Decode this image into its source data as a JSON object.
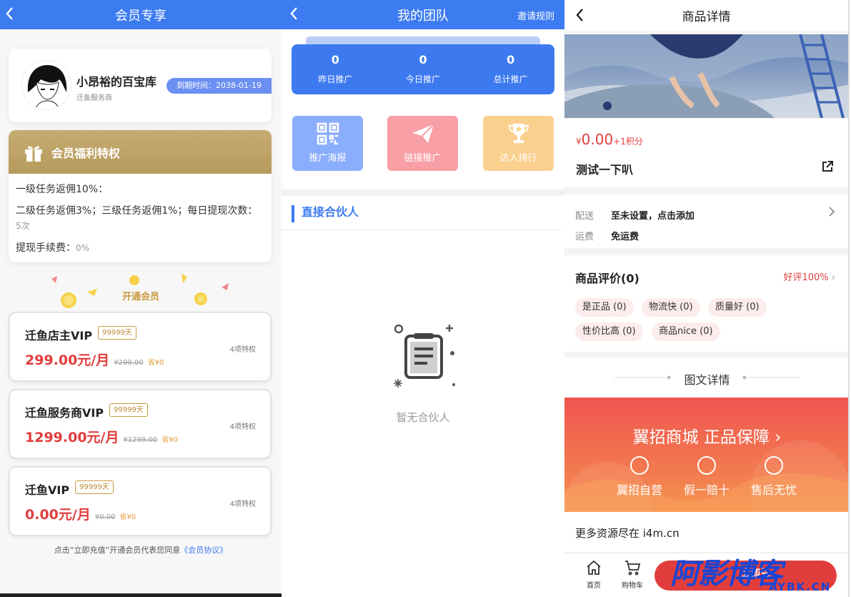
{
  "panel1": {
    "title": "会员专享",
    "user": {
      "name": "小昂裕的百宝库",
      "role": "迁鱼服务商",
      "expire": "到期时间：2038-01-19"
    },
    "benefit": {
      "title": "会员福利特权",
      "line1": "一级任务返佣10%：",
      "line2": "二级任务返佣3%；三级任务返佣1%；每日提现次数：",
      "line2_value": "5次",
      "line3": "提现手续费：",
      "line3_value": "0%"
    },
    "open_vip": "开通会员",
    "vips": [
      {
        "name": "迁鱼店主VIP",
        "days": "99999天",
        "price": "299.00元/月",
        "orig": "¥299.00",
        "save": "省¥0",
        "perks": "4项特权"
      },
      {
        "name": "迁鱼服务商VIP",
        "days": "99999天",
        "price": "1299.00元/月",
        "orig": "¥1299.00",
        "save": "省¥0",
        "perks": "4项特权"
      },
      {
        "name": "迁鱼VIP",
        "days": "99999天",
        "price": "0.00元/月",
        "orig": "¥0.00",
        "save": "省¥0",
        "perks": "4项特权"
      }
    ],
    "agree_prefix": "点击“立即充值”开通会员代表您同意",
    "agree_link": "《会员协议》"
  },
  "panel2": {
    "title": "我的团队",
    "right_link": "邀请规则",
    "stats": [
      {
        "num": "0",
        "label": "昨日推广"
      },
      {
        "num": "0",
        "label": "今日推广"
      },
      {
        "num": "0",
        "label": "总计推广"
      }
    ],
    "tiles": [
      {
        "label": "推广海报",
        "color": "#8aaefb"
      },
      {
        "label": "链接推广",
        "color": "#f99fa6"
      },
      {
        "label": "达人排行",
        "color": "#fbd08f"
      }
    ],
    "section": "直接合伙人",
    "empty": "暂无合伙人"
  },
  "panel3": {
    "title": "商品详情",
    "price": "0.00",
    "price_symbol": "¥",
    "points": "+1积分",
    "product": "测试一下叭",
    "ship_label": "配送",
    "ship_value": "至未设置，点击添加",
    "fee_label": "运费",
    "fee_value": "免运费",
    "reviews_title": "商品评价(0)",
    "good_rate": "好评100%",
    "tags": [
      "是正品 (0)",
      "物流快 (0)",
      "质量好 (0)",
      "性价比高 (0)",
      "商品nice (0)"
    ],
    "detail_title": "图文详情",
    "banner_title": "翼招商城 正品保障 ›",
    "banner_feats": [
      "翼招自营",
      "假一赔十",
      "售后无忧"
    ],
    "more": "更多资源尽在 i4m.cn",
    "tabs": [
      "首页",
      "购物车"
    ],
    "watermark": "阿影博客",
    "watermark_sub": "AYBK.CN",
    "buy_fragment": "立即兑"
  }
}
